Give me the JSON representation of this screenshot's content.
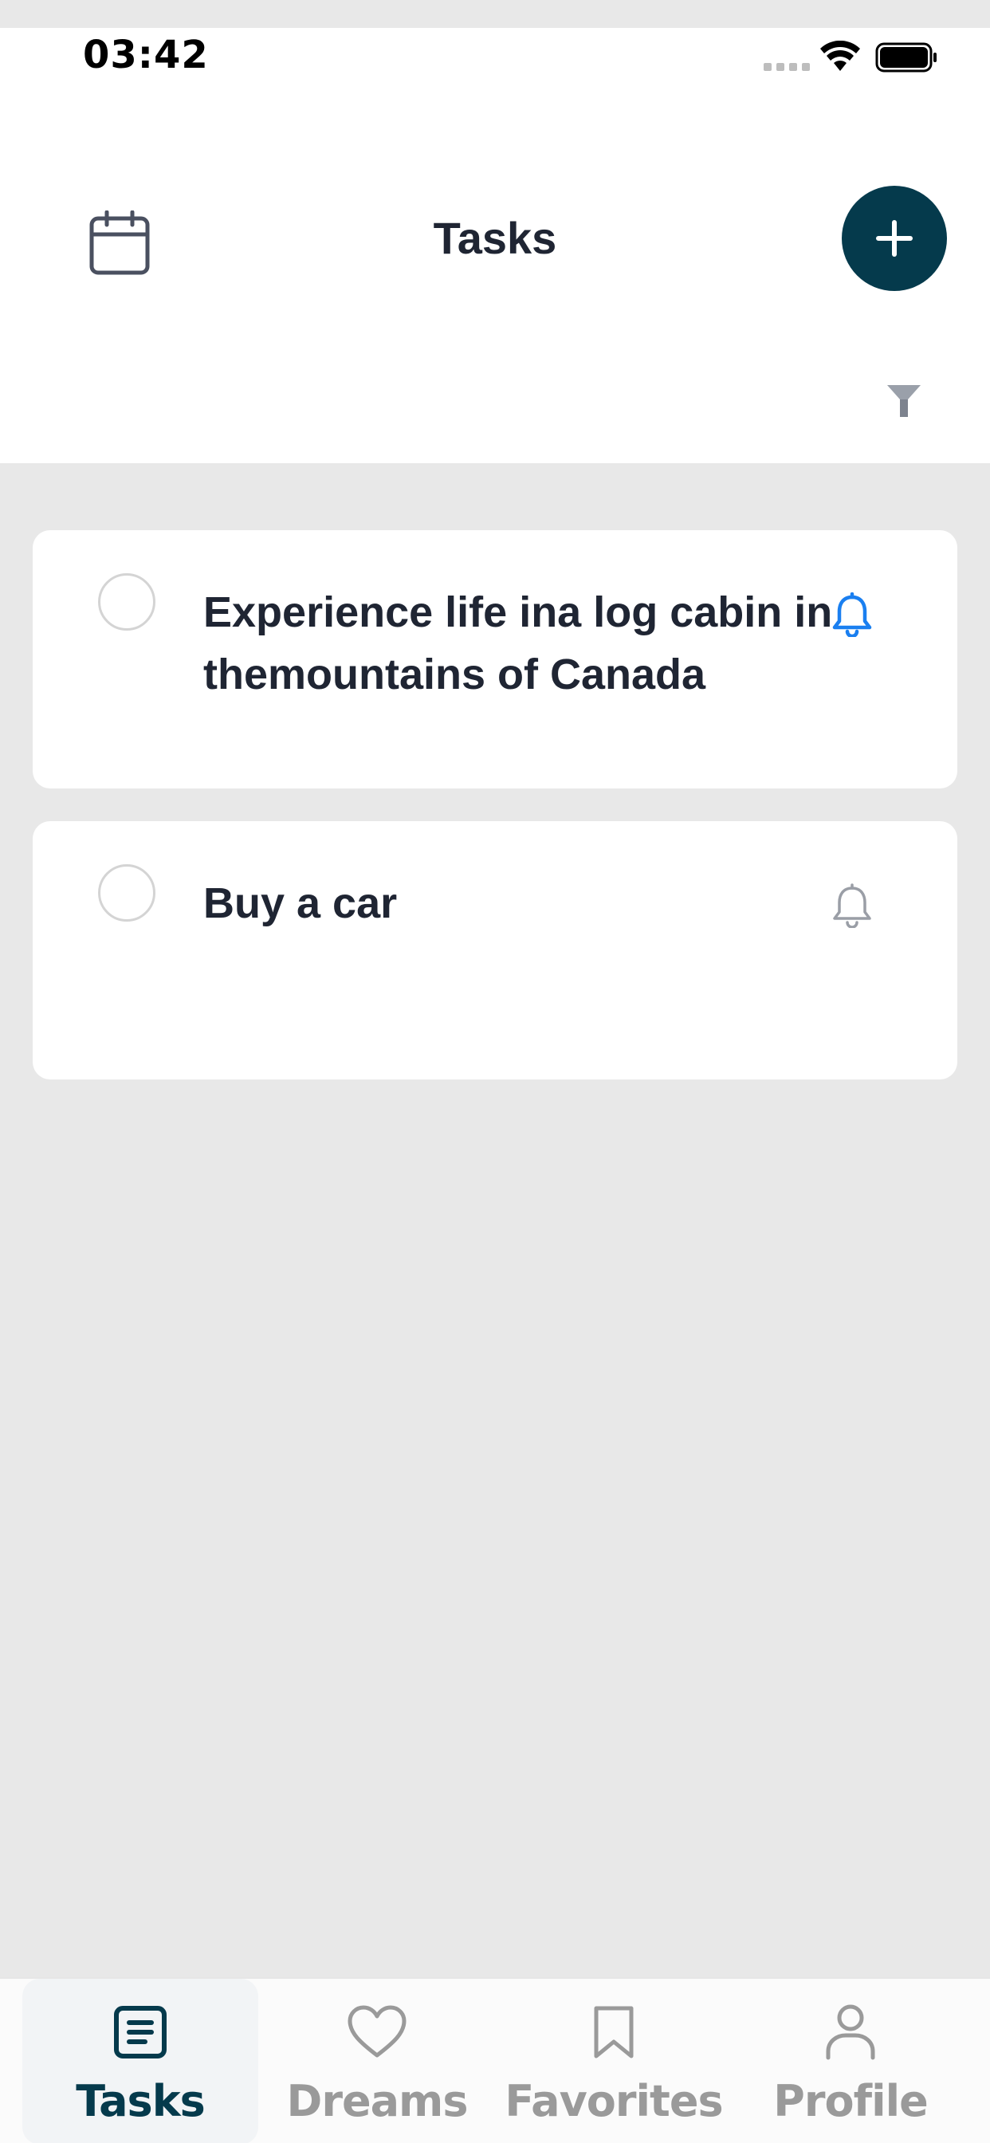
{
  "status_bar": {
    "time": "03:42",
    "icons": [
      "signal-icon",
      "wifi-icon",
      "battery-icon"
    ]
  },
  "header": {
    "title": "Tasks",
    "calendar_icon": "calendar-icon",
    "add_icon": "plus-icon",
    "filter_icon": "filter-icon"
  },
  "tasks": [
    {
      "title": "Experience life ina log cabin in themountains of Canada",
      "reminder_active": true
    },
    {
      "title": "Buy a car",
      "reminder_active": false
    }
  ],
  "bottom_nav": {
    "items": [
      {
        "label": "Tasks",
        "icon": "tasks-icon",
        "active": true
      },
      {
        "label": "Dreams",
        "icon": "heart-icon",
        "active": false
      },
      {
        "label": "Favorites",
        "icon": "bookmark-icon",
        "active": false
      },
      {
        "label": "Profile",
        "icon": "user-icon",
        "active": false
      }
    ]
  },
  "colors": {
    "primary": "#053a4c",
    "reminder_active": "#1a7ff0",
    "reminder_inactive": "#9a9ea6",
    "background": "#e8e8e8"
  }
}
